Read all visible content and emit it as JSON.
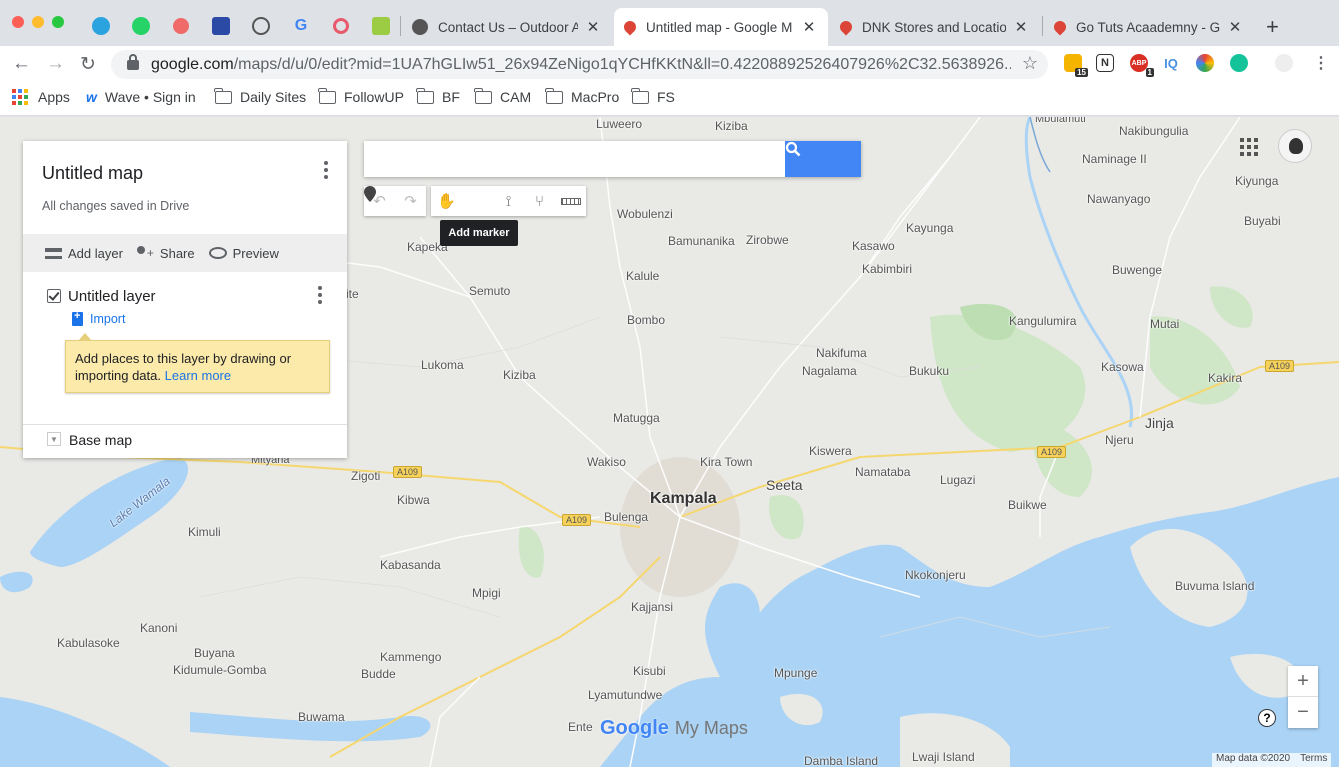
{
  "browser": {
    "tabs": [
      {
        "title": "Contact Us – Outdoor Ad",
        "favicon": "globe-icon"
      },
      {
        "title": "Untitled map - Google M",
        "favicon": "maps-pin-icon",
        "active": true
      },
      {
        "title": "DNK Stores and Location",
        "favicon": "maps-pin-icon"
      },
      {
        "title": "Go Tuts Acaademny - Go",
        "favicon": "maps-pin-icon"
      }
    ],
    "url_host": "google.com",
    "url_path": "/maps/d/u/0/edit?mid=1UA7hGLIw51_26x94ZeNigo1qYCHfKKtN&ll=0.42208892526407926%2C32.5638926...",
    "extensions": [
      {
        "label": "15"
      },
      {
        "label": "N"
      },
      {
        "label": "1"
      },
      {
        "label": "IQ"
      }
    ],
    "bookmarks": [
      "Apps",
      "Wave • Sign in",
      "Daily Sites",
      "FollowUP",
      "BF",
      "CAM",
      "MacPro",
      "FS"
    ]
  },
  "panel": {
    "map_title": "Untitled map",
    "saved_status": "All changes saved in Drive",
    "add_layer": "Add layer",
    "share": "Share",
    "preview": "Preview",
    "layer_title": "Untitled layer",
    "import": "Import",
    "tip_text": "Add places to this layer by drawing or importing data.",
    "tip_link": "Learn more",
    "base_map": "Base map"
  },
  "search": {
    "placeholder": ""
  },
  "tools": {
    "tooltip": "Add marker"
  },
  "map": {
    "places": [
      {
        "name": "Luweero"
      },
      {
        "name": "Kiziba"
      },
      {
        "name": "Mbulamuti"
      },
      {
        "name": "Nakibungulia"
      },
      {
        "name": "Naminage II"
      },
      {
        "name": "Kiyunga"
      },
      {
        "name": "Nawanyago"
      },
      {
        "name": "Buyabi"
      },
      {
        "name": "Wobulenzi"
      },
      {
        "name": "Kayunga"
      },
      {
        "name": "Bamunanika"
      },
      {
        "name": "Zirobwe"
      },
      {
        "name": "Kasawo"
      },
      {
        "name": "Kapeka"
      },
      {
        "name": "Kalule"
      },
      {
        "name": "Kabimbiri"
      },
      {
        "name": "Buwenge"
      },
      {
        "name": "Semuto"
      },
      {
        "name": "Kangulumira"
      },
      {
        "name": "Mutai"
      },
      {
        "name": "Bombo"
      },
      {
        "name": "Nakifuma"
      },
      {
        "name": "Lukoma"
      },
      {
        "name": "Kiziba"
      },
      {
        "name": "Nagalama"
      },
      {
        "name": "Bukuku"
      },
      {
        "name": "Kasowa"
      },
      {
        "name": "Kakira"
      },
      {
        "name": "Matugga"
      },
      {
        "name": "Njeru"
      },
      {
        "name": "Jinja"
      },
      {
        "name": "Kiswera"
      },
      {
        "name": "Mityana"
      },
      {
        "name": "Wakiso"
      },
      {
        "name": "Kira Town"
      },
      {
        "name": "Namataba"
      },
      {
        "name": "Zigoti"
      },
      {
        "name": "Lugazi"
      },
      {
        "name": "Kampala"
      },
      {
        "name": "Seeta"
      },
      {
        "name": "Kibwa"
      },
      {
        "name": "Buikwe"
      },
      {
        "name": "Bulenga"
      },
      {
        "name": "Kimuli"
      },
      {
        "name": "Kabasanda"
      },
      {
        "name": "Nkokonjeru"
      },
      {
        "name": "Buvuma Island"
      },
      {
        "name": "Mpigi"
      },
      {
        "name": "Kajjansi"
      },
      {
        "name": "Kanoni"
      },
      {
        "name": "Kabulasoke"
      },
      {
        "name": "Buyana"
      },
      {
        "name": "Kammengo"
      },
      {
        "name": "Kidumule-Gomba"
      },
      {
        "name": "Mpunge"
      },
      {
        "name": "Kisubi"
      },
      {
        "name": "Budde"
      },
      {
        "name": "Lyamutundwe"
      },
      {
        "name": "Buwama"
      },
      {
        "name": "Ente"
      },
      {
        "name": "Lwaji Island"
      },
      {
        "name": "Damba Island"
      },
      {
        "name": "Lake Wamala"
      },
      {
        "name": "ite"
      }
    ],
    "road_shields": [
      "A109",
      "A109",
      "A109",
      "A109"
    ],
    "logo_google": "Google",
    "logo_suffix": "My Maps",
    "attribution": "Map data ©2020",
    "terms": "Terms",
    "zoom_in": "+",
    "zoom_out": "−"
  }
}
